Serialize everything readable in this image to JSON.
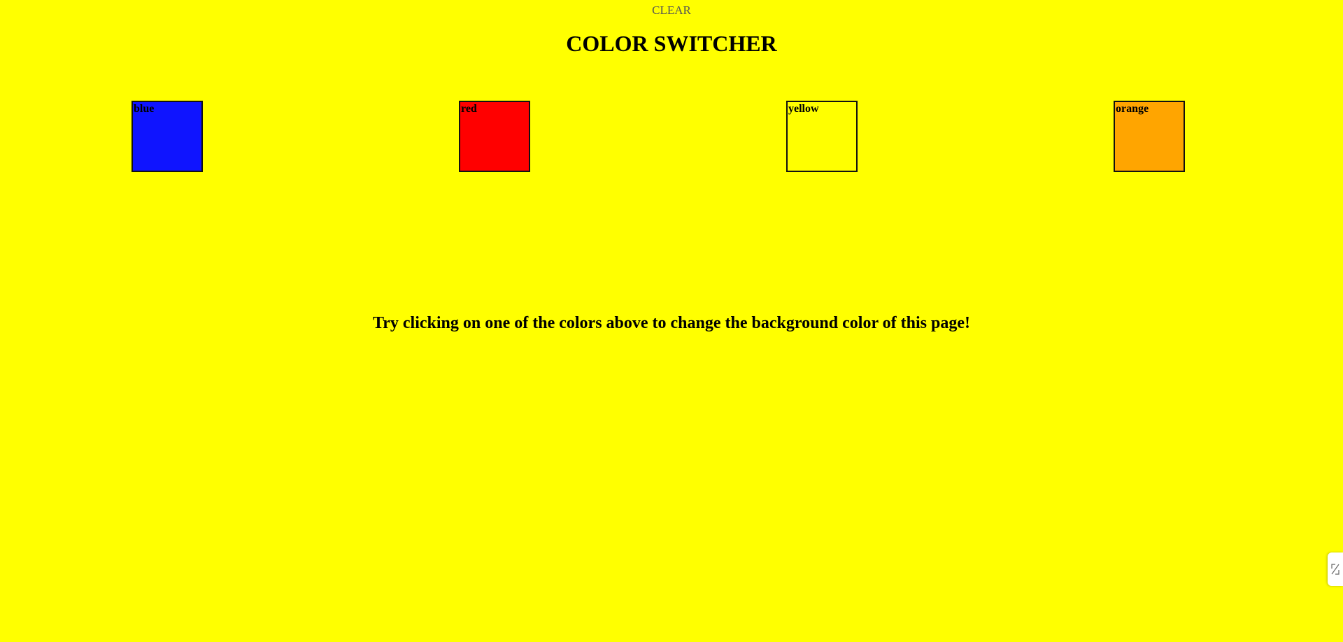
{
  "page": {
    "background_color": "#ffff00"
  },
  "header": {
    "clear_label": "CLEAR",
    "title": "COLOR SWITCHER"
  },
  "swatches": [
    {
      "label": "blue",
      "color": "#0f14ff"
    },
    {
      "label": "red",
      "color": "#ff0000"
    },
    {
      "label": "yellow",
      "color": "#ffff00"
    },
    {
      "label": "orange",
      "color": "#ffa500"
    }
  ],
  "main": {
    "instructions": "Try clicking on one of the colors above to change the background color of this page!"
  },
  "side_tab": {
    "icon": "collapse-arrows-icon"
  }
}
